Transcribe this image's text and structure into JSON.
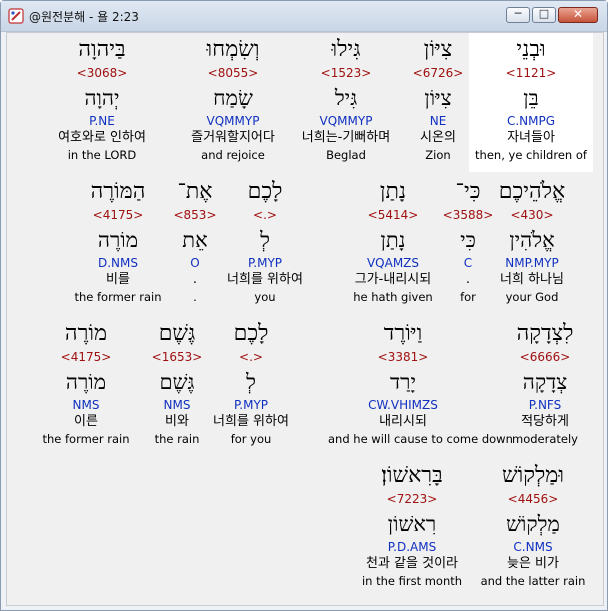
{
  "window": {
    "title": "@원전분해 - 욜 2:23",
    "buttons": {
      "minimize": "─",
      "maximize": "□",
      "close": "✕"
    }
  },
  "verse": {
    "rows": [
      {
        "words": [
          {
            "hebrew": "וּבְנֵי",
            "strong": "<1121>",
            "lemma": "בֵּן",
            "morph": "C.NMPG",
            "korean": "자녀들아",
            "english": "then, ye children of",
            "selected": true
          },
          {
            "hebrew": "צִיּוֹן",
            "strong": "<6726>",
            "lemma": "צִיּוֹן",
            "morph": "NE",
            "korean": "시온의",
            "english": "Zion"
          },
          {
            "hebrew": "גִּילוּ",
            "strong": "<1523>",
            "lemma": "גִּיל",
            "morph": "VQMMYP",
            "korean": "너희는-기뻐하며",
            "english": "Beglad"
          },
          {
            "hebrew": "וְשִׂמְחוּ",
            "strong": "<8055>",
            "lemma": "שָׂמַח",
            "morph": "VQMMYP",
            "korean": "즐거워할지어다",
            "english": "and rejoice"
          },
          {
            "hebrew": "בַּיהוָה",
            "strong": "<3068>",
            "lemma": "יְהוָה",
            "morph": "P.NE",
            "korean": "여호와로 인하여",
            "english": "in the LORD"
          }
        ]
      },
      {
        "words": [
          {
            "hebrew": "אֱלֹהֵיכֶם",
            "strong": "<430>",
            "lemma": "אֱלֹהִין",
            "morph": "NMP.MYP",
            "korean": "너희 하나님",
            "english": "your God"
          },
          {
            "hebrew": "כִּי־",
            "strong": "<3588>",
            "lemma": "כִּי",
            "morph": "C",
            "korean": ".",
            "english": "for"
          },
          {
            "hebrew": "נָתַן",
            "strong": "<5414>",
            "lemma": "נָתַן",
            "morph": "VQAMZS",
            "korean": "그가-내리시되",
            "english": "he hath given"
          },
          {
            "hebrew": "לָכֶם",
            "strong": "<.>",
            "lemma": "לְ",
            "morph": "P.MYP",
            "korean": "너희를 위하여",
            "english": "you"
          },
          {
            "hebrew": "אֶת־",
            "strong": "<853>",
            "lemma": "אֵת",
            "morph": "O",
            "korean": ".",
            "english": "."
          },
          {
            "hebrew": "הַמּוֹרֶה",
            "strong": "<4175>",
            "lemma": "מוֹרֶה",
            "morph": "D.NMS",
            "korean": "비를",
            "english": "the former rain"
          }
        ]
      },
      {
        "words": [
          {
            "hebrew": "לִצְדָקָה",
            "strong": "<6666>",
            "lemma": "צְדָקָה",
            "morph": "P.NFS",
            "korean": "적당하게",
            "english": "moderately"
          },
          {
            "hebrew": "וַיּוֹרֶד",
            "strong": "<3381>",
            "lemma": "יָרַד",
            "morph": "CW.VHIMZS",
            "korean": "내리시되",
            "english": "and he will cause to come down"
          },
          {
            "hebrew": "לָכֶם",
            "strong": "<.>",
            "lemma": "לְ",
            "morph": "P.MYP",
            "korean": "너희를 위하여",
            "english": "for you"
          },
          {
            "hebrew": "גֶּשֶׁם",
            "strong": "<1653>",
            "lemma": "גֶּשֶׁם",
            "morph": "NMS",
            "korean": "비와",
            "english": "the rain"
          },
          {
            "hebrew": "מוֹרֶה",
            "strong": "<4175>",
            "lemma": "מוֹרֶה",
            "morph": "NMS",
            "korean": "이른",
            "english": "the former rain"
          }
        ]
      },
      {
        "words": [
          {
            "hebrew": "וּמַלְקוֹשׁ",
            "strong": "<4456>",
            "lemma": "מַלְקוֹשׁ",
            "morph": "C.NMS",
            "korean": "늦은 비가",
            "english": "and the latter rain"
          },
          {
            "hebrew": "בָּרִאשׁוֹן׃",
            "strong": "<7223>",
            "lemma": "רִאשׁוֹן",
            "morph": "P.D.AMS",
            "korean": "천과 같을 것이라",
            "english": "in the first month"
          }
        ]
      }
    ]
  }
}
